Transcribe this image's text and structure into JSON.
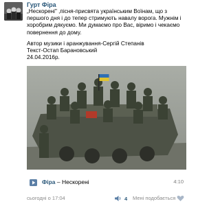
{
  "post": {
    "author": "Гурт Фіра",
    "text_line1": "„Нескорені\" ,пісня-присвята українським Воїнам, що з першого дня і до тепер стримують навалу ворога. Мужнім і хоробрим дякуємо. Ми думаємо про Вас, віримо і чекаємо повернення до дому.",
    "credit_music": "Автор музики і аранжування-Сергій Степанів",
    "credit_text": "Текст-Остап Барановський",
    "credit_date": "24.04.2016р."
  },
  "audio": {
    "artist": "Фіра",
    "separator": " – ",
    "title": "Нескорені",
    "duration": "4:10"
  },
  "footer": {
    "timestamp": "сьогодні о 17:04",
    "likes_count": "4",
    "like_label": "Мені подобається",
    "icons": [
      "speaker-icon",
      "play-icon",
      "heart-icon"
    ]
  },
  "colors": {
    "link": "#2b587a",
    "muted": "#8a8a8a",
    "play": "#5b7fa6"
  }
}
